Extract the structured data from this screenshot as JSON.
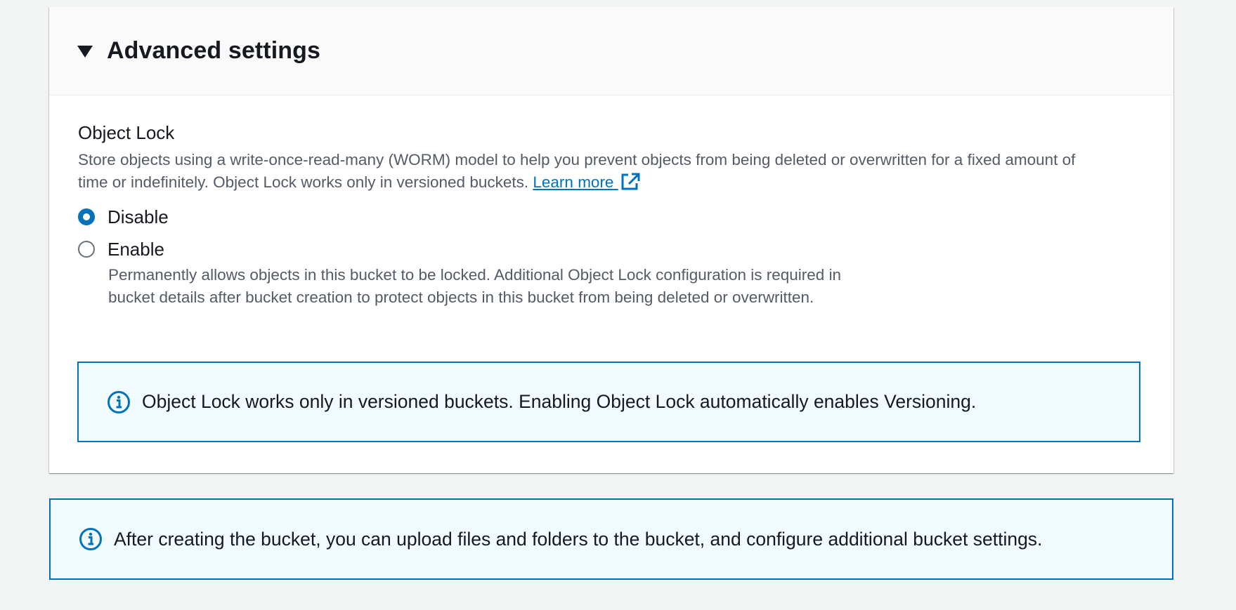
{
  "advanced_settings": {
    "title": "Advanced settings",
    "object_lock": {
      "label": "Object Lock",
      "description": "Store objects using a write-once-read-many (WORM) model to help you prevent objects from being deleted or overwritten for a fixed amount of time or indefinitely. Object Lock works only in versioned buckets.",
      "learn_more": "Learn more",
      "options": [
        {
          "label": "Disable",
          "selected": true
        },
        {
          "label": "Enable",
          "selected": false,
          "description": "Permanently allows objects in this bucket to be locked. Additional Object Lock configuration is required in bucket details after bucket creation to protect objects in this bucket from being deleted or overwritten."
        }
      ]
    },
    "info_alert": "Object Lock works only in versioned buckets. Enabling Object Lock automatically enables Versioning."
  },
  "footer_alert": "After creating the bucket, you can upload files and folders to the bucket, and configure additional bucket settings.",
  "colors": {
    "accent": "#0073bb",
    "alert_background": "#f1faff",
    "secondary_text": "#545b64"
  },
  "icons": [
    "caret-down-icon",
    "external-link-icon",
    "info-icon"
  ]
}
